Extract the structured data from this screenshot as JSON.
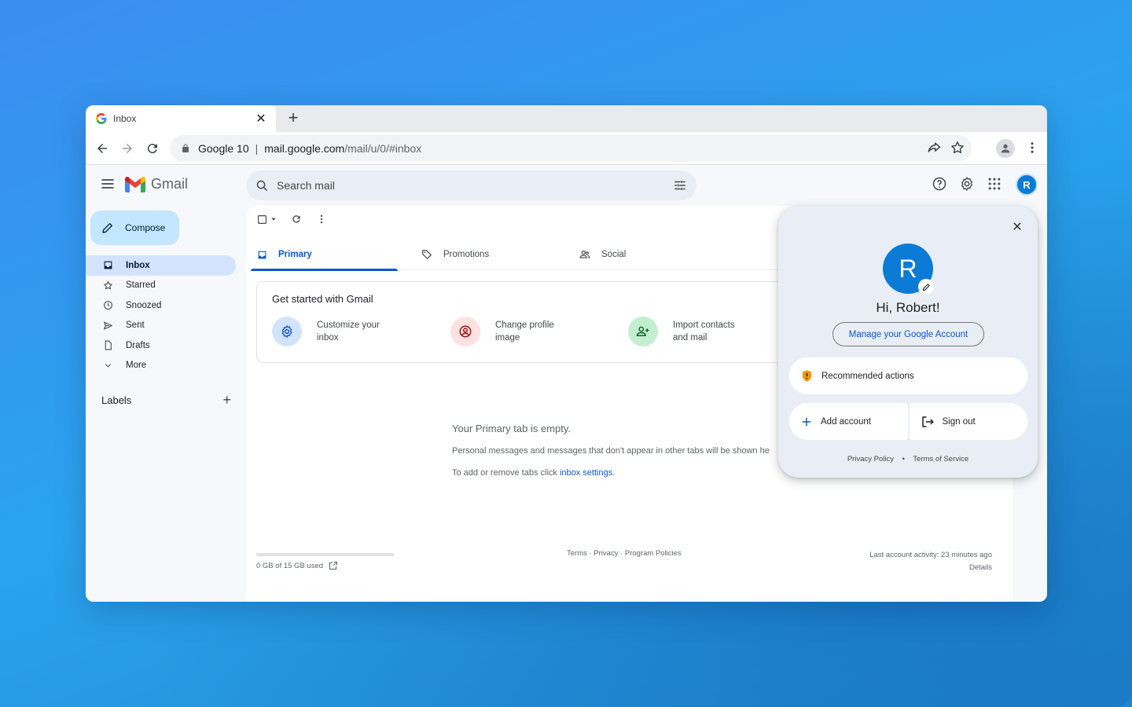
{
  "browser": {
    "tab_title": "Inbox",
    "url_prefix": "Google 10",
    "url_host": "mail.google.com",
    "url_path": "/mail/u/0/#inbox"
  },
  "gmail": {
    "app_name": "Gmail",
    "search_placeholder": "Search mail",
    "avatar_letter": "R",
    "compose_label": "Compose",
    "nav": [
      {
        "label": "Inbox",
        "icon": "inbox-icon",
        "active": true
      },
      {
        "label": "Starred",
        "icon": "star-icon"
      },
      {
        "label": "Snoozed",
        "icon": "clock-icon"
      },
      {
        "label": "Sent",
        "icon": "send-icon"
      },
      {
        "label": "Drafts",
        "icon": "draft-icon"
      },
      {
        "label": "More",
        "icon": "chevron-down-icon"
      }
    ],
    "labels_title": "Labels",
    "tabs": [
      {
        "label": "Primary",
        "icon": "inbox-icon",
        "active": true
      },
      {
        "label": "Promotions",
        "icon": "tag-icon"
      },
      {
        "label": "Social",
        "icon": "people-icon"
      }
    ],
    "get_started": {
      "title": "Get started with Gmail",
      "items": [
        {
          "label": "Customize your inbox",
          "icon": "gear-icon",
          "color": "#d3e3fd"
        },
        {
          "label": "Change profile image",
          "icon": "account-circle-icon",
          "color": "#fde2e1"
        },
        {
          "label": "Import contacts and mail",
          "icon": "person-add-icon",
          "color": "#c4eed0"
        }
      ]
    },
    "empty": {
      "title": "Your Primary tab is empty.",
      "line1": "Personal messages and messages that don't appear in other tabs will be shown he",
      "line2_prefix": "To add or remove tabs click ",
      "line2_link": "inbox settings",
      "line2_suffix": "."
    },
    "footer": {
      "storage": "0 GB of 15 GB used",
      "links": "Terms · Privacy · Program Policies",
      "activity": "Last account activity: 23 minutes ago",
      "details": "Details"
    }
  },
  "account_popover": {
    "avatar_letter": "R",
    "greeting": "Hi, Robert!",
    "manage_label": "Manage your Google Account",
    "recommended_label": "Recommended actions",
    "add_account_label": "Add account",
    "sign_out_label": "Sign out",
    "privacy_label": "Privacy Policy",
    "separator": "•",
    "terms_label": "Terms of Service"
  },
  "colors": {
    "accent": "#0b57d0",
    "compose_bg": "#c2e7ff",
    "avatar": "#0b7bd6",
    "warning": "#f29900"
  }
}
